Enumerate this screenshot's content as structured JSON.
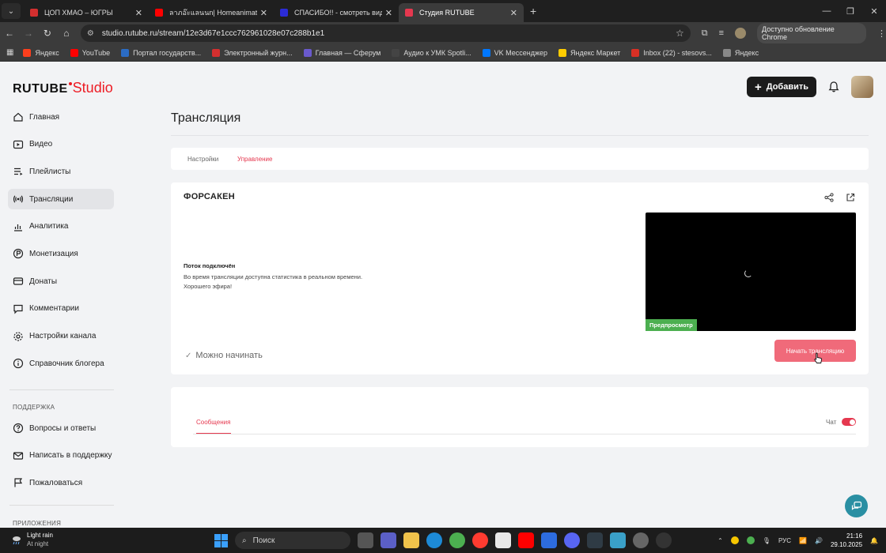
{
  "browser": {
    "tabs": [
      {
        "title": "ЦОП ХМАО – ЮГРЫ",
        "color": "#d32f2f",
        "active": false
      },
      {
        "title": "ลาภอ๊ะแลนนn| Homeanimations",
        "color": "#ff0000",
        "active": false
      },
      {
        "title": "СПАСИБО!! - смотреть видео",
        "color": "#2b2bd6",
        "active": false
      },
      {
        "title": "Студия RUTUBE",
        "color": "#e5384f",
        "active": true
      }
    ],
    "url": "studio.rutube.ru/stream/12e3d67e1ccc762961028e07c288b1e1",
    "update_label": "Доступно обновление Chrome",
    "bookmarks": [
      {
        "label": "Яндекс",
        "color": "#fc3f1d"
      },
      {
        "label": "YouTube",
        "color": "#ff0000"
      },
      {
        "label": "Портал государств...",
        "color": "#2b6cc4"
      },
      {
        "label": "Электронный журн...",
        "color": "#d32f2f"
      },
      {
        "label": "Главная — Сферум",
        "color": "#6a5acd"
      },
      {
        "label": "Аудио к УМК Spotli...",
        "color": "#444444"
      },
      {
        "label": "VK Мессенджер",
        "color": "#0077ff"
      },
      {
        "label": "Яндекс Маркет",
        "color": "#ffcc00"
      },
      {
        "label": "Inbox (22) - stesovs...",
        "color": "#d93025"
      },
      {
        "label": "Яндекс",
        "color": "#888888"
      }
    ]
  },
  "studio": {
    "logo_main": "RUTUBE",
    "logo_accent": "Studio",
    "add_label": "Добавить",
    "nav": [
      {
        "label": "Главная",
        "icon": "home-icon"
      },
      {
        "label": "Видео",
        "icon": "video-icon"
      },
      {
        "label": "Плейлисты",
        "icon": "playlist-icon"
      },
      {
        "label": "Трансляции",
        "icon": "broadcast-icon",
        "active": true
      },
      {
        "label": "Аналитика",
        "icon": "analytics-icon"
      },
      {
        "label": "Монетизация",
        "icon": "monetization-icon"
      },
      {
        "label": "Донаты",
        "icon": "donate-icon"
      },
      {
        "label": "Комментарии",
        "icon": "comment-icon"
      },
      {
        "label": "Настройки канала",
        "icon": "gear-icon"
      },
      {
        "label": "Справочник блогера",
        "icon": "info-icon"
      }
    ],
    "support_heading": "ПОДДЕРЖКА",
    "support_nav": [
      {
        "label": "Вопросы и ответы",
        "icon": "help-icon"
      },
      {
        "label": "Написать в поддержку",
        "icon": "mail-icon"
      },
      {
        "label": "Пожаловаться",
        "icon": "flag-icon"
      }
    ],
    "apps_heading": "ПРИЛОЖЕНИЯ"
  },
  "stream": {
    "page_title": "Трансляция",
    "tabs": [
      "Настройки",
      "Управление"
    ],
    "name": "ФОРСАКЕН",
    "status_title": "Поток подключён",
    "status_line1": "Во время трансляции доступна статистика в реальном времени.",
    "status_line2": "Хорошего эфира!",
    "preview_label": "Предпросмотр",
    "ready_label": "Можно начинать",
    "start_label": "Начать трансляцию",
    "messages_tab": "Сообщения",
    "chat_label": "Чат",
    "chat_enabled": true
  },
  "taskbar": {
    "weather_title": "Light rain",
    "weather_sub": "At night",
    "search_label": "Поиск",
    "lang": "РУС",
    "time": "21:16",
    "date": "29.10.2025"
  }
}
